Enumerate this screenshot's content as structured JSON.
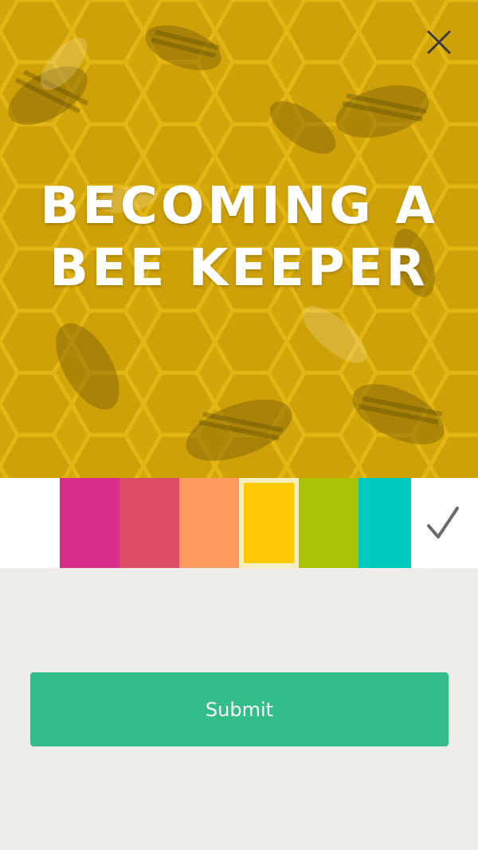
{
  "hero": {
    "title_line1": "Becoming a",
    "title_line2": "Bee Keeper",
    "tint_color": "#d3a70a",
    "close_icon": "close-icon"
  },
  "color_picker": {
    "swatches": [
      {
        "color": "#ffffff",
        "selected": false
      },
      {
        "color": "#d82e8a",
        "selected": false
      },
      {
        "color": "#dd4e66",
        "selected": false
      },
      {
        "color": "#fe9a5c",
        "selected": false
      },
      {
        "color": "#ffc903",
        "selected": true
      },
      {
        "color": "#a9c404",
        "selected": false
      },
      {
        "color": "#00cbbe",
        "selected": false
      }
    ],
    "confirm_icon": "checkmark-icon"
  },
  "submit": {
    "label": "Submit",
    "color": "#33bd88"
  }
}
